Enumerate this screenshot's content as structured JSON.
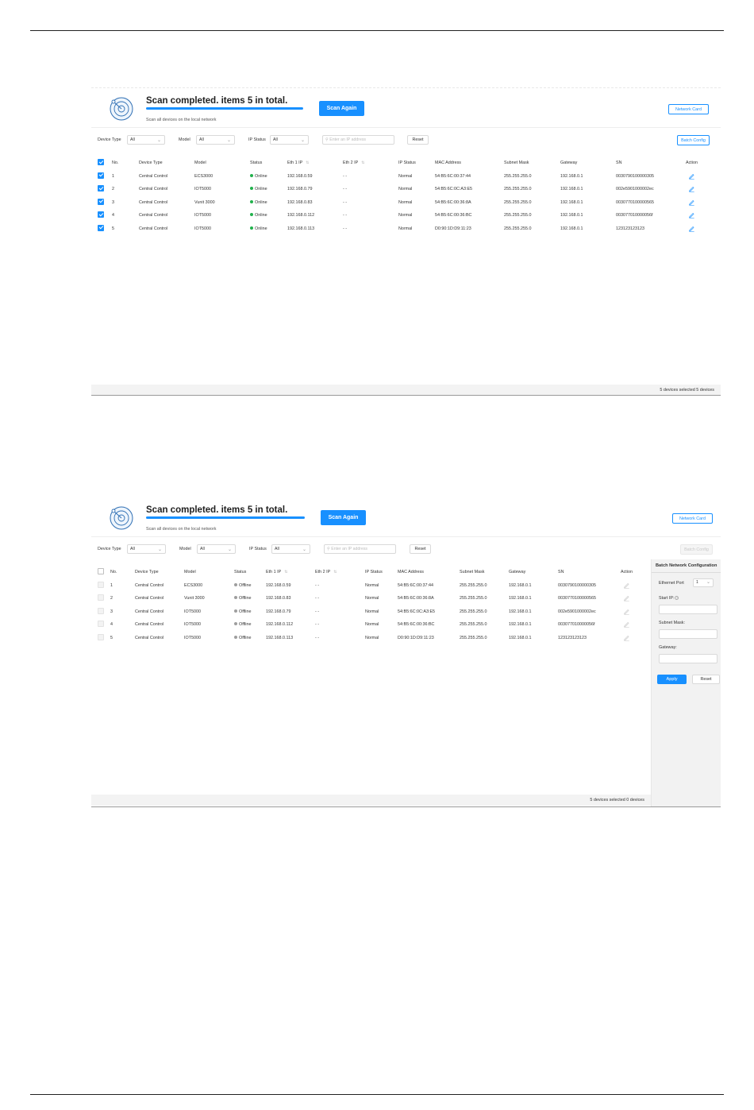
{
  "screenshots": [
    {
      "scan": {
        "title": "Scan completed. items 5 in total.",
        "subtitle": "Scan all devices on the local network",
        "scan_again": "Scan Again",
        "network_card": "Network Card"
      },
      "filters": {
        "device_type_label": "Device Type",
        "device_type_value": "All",
        "model_label": "Model",
        "model_value": "All",
        "ip_status_label": "IP Status",
        "ip_status_value": "All",
        "search_placeholder": "Enter an IP address",
        "reset": "Reset",
        "batch_config": "Batch Config"
      },
      "columns": [
        "No.",
        "Device Type",
        "Model",
        "Status",
        "Eth 1 IP",
        "Eth 2 IP",
        "IP Status",
        "MAC Address",
        "Subnet Mask",
        "Gateway",
        "SN",
        "Action"
      ],
      "rows": [
        {
          "no": "1",
          "device_type": "Central Control",
          "model": "ECS3000",
          "status": "Online",
          "eth1": "192.168.0.59",
          "eth2": "- -",
          "ip_status": "Normal",
          "mac": "54:B5:6C:00:37:44",
          "mask": "255.255.255.0",
          "gateway": "192.168.0.1",
          "sn": "0030790100000305"
        },
        {
          "no": "2",
          "device_type": "Central Control",
          "model": "IOT5000",
          "status": "Online",
          "eth1": "192.168.0.79",
          "eth2": "- -",
          "ip_status": "Normal",
          "mac": "54:B5:6C:0C:A3:E5",
          "mask": "255.255.255.0",
          "gateway": "192.168.0.1",
          "sn": "002e5901000002ec"
        },
        {
          "no": "3",
          "device_type": "Central Control",
          "model": "Vunit 3000",
          "status": "Online",
          "eth1": "192.168.0.83",
          "eth2": "- -",
          "ip_status": "Normal",
          "mac": "54:B5:6C:00:36:8A",
          "mask": "255.255.255.0",
          "gateway": "192.168.0.1",
          "sn": "0030770100000565"
        },
        {
          "no": "4",
          "device_type": "Central Control",
          "model": "IOT5000",
          "status": "Online",
          "eth1": "192.168.0.112",
          "eth2": "- -",
          "ip_status": "Normal",
          "mac": "54:B5:6C:00:36:BC",
          "mask": "255.255.255.0",
          "gateway": "192.168.0.1",
          "sn": "003077010000056f"
        },
        {
          "no": "5",
          "device_type": "Central Control",
          "model": "IOT5000",
          "status": "Online",
          "eth1": "192.168.0.113",
          "eth2": "- -",
          "ip_status": "Normal",
          "mac": "D0:90:1D:D9:11:23",
          "mask": "255.255.255.0",
          "gateway": "192.168.0.1",
          "sn": "123123123123"
        }
      ],
      "footer": "5 devices  selected 5 devices"
    },
    {
      "scan": {
        "title": "Scan completed. items 5 in total.",
        "subtitle": "Scan all devices on the local network",
        "scan_again": "Scan Again",
        "network_card": "Network Card"
      },
      "filters": {
        "device_type_label": "Device Type",
        "device_type_value": "All",
        "model_label": "Model",
        "model_value": "All",
        "ip_status_label": "IP Status",
        "ip_status_value": "All",
        "search_placeholder": "Enter an IP address",
        "reset": "Reset",
        "batch_config": "Batch Config"
      },
      "columns": [
        "No.",
        "Device Type",
        "Model",
        "Status",
        "Eth 1 IP",
        "Eth 2 IP",
        "IP Status",
        "MAC Address",
        "Subnet Mask",
        "Gateway",
        "SN",
        "Action"
      ],
      "rows": [
        {
          "no": "1",
          "device_type": "Central Control",
          "model": "ECS3000",
          "status": "Offline",
          "eth1": "192.168.0.59",
          "eth2": "- -",
          "ip_status": "Normal",
          "mac": "54:B5:6C:00:37:44",
          "mask": "255.255.255.0",
          "gateway": "192.168.0.1",
          "sn": "0030790100000305"
        },
        {
          "no": "2",
          "device_type": "Central Control",
          "model": "Vunit 3000",
          "status": "Offline",
          "eth1": "192.168.0.83",
          "eth2": "- -",
          "ip_status": "Normal",
          "mac": "54:B5:6C:00:36:8A",
          "mask": "255.255.255.0",
          "gateway": "192.168.0.1",
          "sn": "0030770100000565"
        },
        {
          "no": "3",
          "device_type": "Central Control",
          "model": "IOT5000",
          "status": "Offline",
          "eth1": "192.168.0.79",
          "eth2": "- -",
          "ip_status": "Normal",
          "mac": "54:B5:6C:0C:A3:E5",
          "mask": "255.255.255.0",
          "gateway": "192.168.0.1",
          "sn": "002e5901000002ec"
        },
        {
          "no": "4",
          "device_type": "Central Control",
          "model": "IOT5000",
          "status": "Offline",
          "eth1": "192.168.0.112",
          "eth2": "- -",
          "ip_status": "Normal",
          "mac": "54:B5:6C:00:36:BC",
          "mask": "255.255.255.0",
          "gateway": "192.168.0.1",
          "sn": "003077010000056f"
        },
        {
          "no": "5",
          "device_type": "Central Control",
          "model": "IOT5000",
          "status": "Offline",
          "eth1": "192.168.0.113",
          "eth2": "- -",
          "ip_status": "Normal",
          "mac": "D0:90:1D:D9:11:23",
          "mask": "255.255.255.0",
          "gateway": "192.168.0.1",
          "sn": "123123123123"
        }
      ],
      "footer": "5 devices  selected 0 devices",
      "batch_panel": {
        "title": "Batch Network Configuration",
        "ethernet_port_label": "Ethernet Port",
        "ethernet_port_value": "1",
        "start_ip_label": "Start IP:",
        "subnet_mask_label": "Subnet Mask:",
        "gateway_label": "Gateway:",
        "apply": "Apply",
        "reset": "Reset"
      }
    }
  ],
  "colors": {
    "accent": "#1890ff",
    "online": "#22b14c",
    "offline": "#9e9e9e"
  },
  "icons": {
    "scan": "radar-icon",
    "search": "search-icon",
    "edit": "edit-icon",
    "dropdown": "chevron-down-icon",
    "sort": "sort-icon",
    "help": "question-circle-icon"
  }
}
